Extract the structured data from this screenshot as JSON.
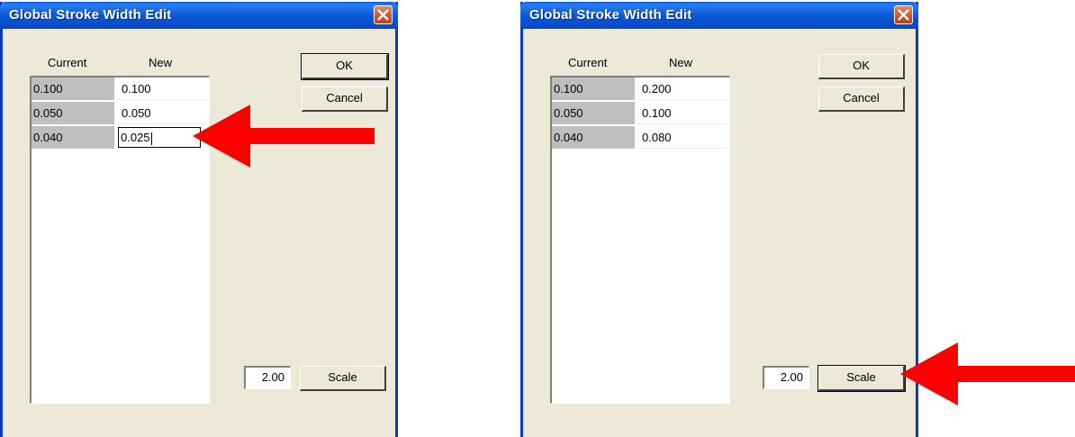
{
  "dialogs": [
    {
      "title": "Global Stroke Width Edit",
      "col_current": "Current",
      "col_new": "New",
      "rows": [
        {
          "current": "0.100",
          "new": "0.100"
        },
        {
          "current": "0.050",
          "new": "0.050"
        },
        {
          "current": "0.040",
          "new": "0.025"
        }
      ],
      "ok_label": "OK",
      "cancel_label": "Cancel",
      "scale_value": "2.00",
      "scale_label": "Scale"
    },
    {
      "title": "Global Stroke Width Edit",
      "col_current": "Current",
      "col_new": "New",
      "rows": [
        {
          "current": "0.100",
          "new": "0.200"
        },
        {
          "current": "0.050",
          "new": "0.100"
        },
        {
          "current": "0.040",
          "new": "0.080"
        }
      ],
      "ok_label": "OK",
      "cancel_label": "Cancel",
      "scale_value": "2.00",
      "scale_label": "Scale"
    }
  ],
  "annotation_color": "#ff0000",
  "icons": {
    "close": "close-x-icon",
    "annotation": "red-arrow-icon"
  }
}
